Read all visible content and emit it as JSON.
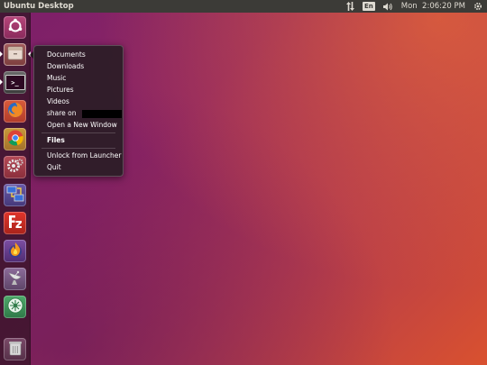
{
  "top_panel": {
    "window_title": "Ubuntu Desktop",
    "keyboard_layout": "En",
    "clock": "Mon  2:06:20 PM",
    "icons": [
      "network-arrows-icon",
      "keyboard-icon",
      "volume-icon",
      "gear-icon"
    ]
  },
  "launcher": {
    "items": [
      {
        "name": "ubuntu-dash",
        "icon": "ubuntu-logo-icon"
      },
      {
        "name": "files",
        "icon": "file-cabinet-icon"
      },
      {
        "name": "terminal",
        "icon": "terminal-icon"
      },
      {
        "name": "firefox",
        "icon": "firefox-icon"
      },
      {
        "name": "chrome",
        "icon": "chrome-icon"
      },
      {
        "name": "system-settings",
        "icon": "settings-gears-icon"
      },
      {
        "name": "network-app",
        "icon": "network-monitor-icon"
      },
      {
        "name": "filezilla",
        "icon": "filezilla-icon"
      },
      {
        "name": "burner-app",
        "icon": "flame-icon"
      },
      {
        "name": "satellite-app",
        "icon": "satellite-dish-icon"
      },
      {
        "name": "network-tool",
        "icon": "network-globe-icon"
      },
      {
        "name": "trash",
        "icon": "trash-icon"
      }
    ],
    "terminal_glyph": ">_"
  },
  "quicklist": {
    "items": [
      {
        "label": "Documents"
      },
      {
        "label": "Downloads"
      },
      {
        "label": "Music"
      },
      {
        "label": "Pictures"
      },
      {
        "label": "Videos"
      },
      {
        "label": "share on"
      },
      {
        "label": "Open a New Window"
      }
    ],
    "app_title": "Files",
    "actions": [
      {
        "label": "Unlock from Launcher"
      },
      {
        "label": "Quit"
      }
    ]
  },
  "colors": {
    "panel": "#3c3b37",
    "launcher": "#371428",
    "wallpaper_start": "#7a1f6a",
    "wallpaper_end": "#d9512f"
  }
}
